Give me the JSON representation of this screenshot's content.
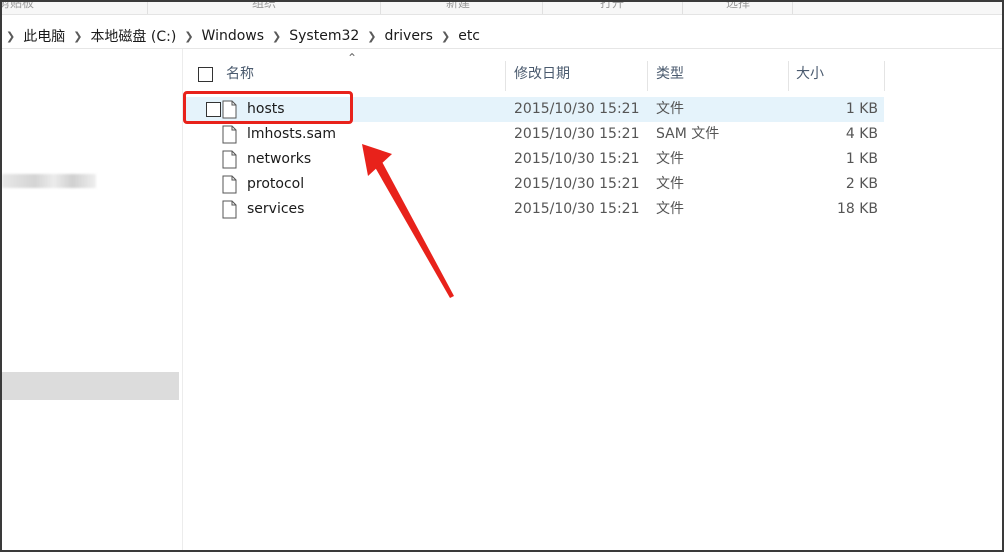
{
  "ribbon": {
    "groups": [
      "剪贴板",
      "组织",
      "新建",
      "打开",
      "选择"
    ]
  },
  "address": {
    "crumbs": [
      "此电脑",
      "本地磁盘 (C:)",
      "Windows",
      "System32",
      "drivers",
      "etc"
    ]
  },
  "columns": {
    "name": "名称",
    "modified": "修改日期",
    "type": "类型",
    "size": "大小"
  },
  "files": [
    {
      "name": "hosts",
      "modified": "2015/10/30 15:21",
      "type": "文件",
      "size": "1 KB",
      "selected": true
    },
    {
      "name": "lmhosts.sam",
      "modified": "2015/10/30 15:21",
      "type": "SAM 文件",
      "size": "4 KB"
    },
    {
      "name": "networks",
      "modified": "2015/10/30 15:21",
      "type": "文件",
      "size": "1 KB"
    },
    {
      "name": "protocol",
      "modified": "2015/10/30 15:21",
      "type": "文件",
      "size": "2 KB"
    },
    {
      "name": "services",
      "modified": "2015/10/30 15:21",
      "type": "文件",
      "size": "18 KB"
    }
  ],
  "annotation": {
    "highlight_color": "#e8221b",
    "arrow_color": "#e8221b",
    "selection_color": "#e5f3fb"
  }
}
